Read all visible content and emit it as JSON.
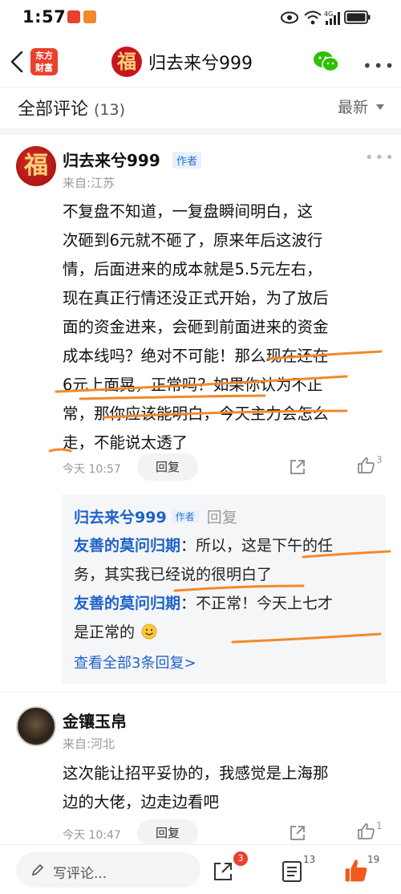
{
  "status": {
    "time": "1:57"
  },
  "nav": {
    "logo_line1": "东方",
    "logo_line2": "财富",
    "avatar_char": "福",
    "title": "归去来兮999"
  },
  "section": {
    "title": "全部评论",
    "count": "(13)",
    "sort": "最新"
  },
  "comments": [
    {
      "avatar_char": "福",
      "name": "归去来兮999",
      "author_tag": "作者",
      "from": "来自:江苏",
      "lines": [
        "不复盘不知道，一复盘瞬间明白，这",
        "次砸到6元就不砸了，原来年后这波行",
        "情，后面进来的成本就是5.5元左右，",
        "现在真正行情还没正式开始，为了放后",
        "面的资金进来，会砸到前面进来的资金",
        "成本线吗？绝对不可能！那么现在还在",
        "6元上面晃，正常吗？如果你认为不正",
        "常，那你应该能明白，今天主力会怎么",
        "走，不能说太透了"
      ],
      "time": "今天 10:57",
      "reply_label": "回复",
      "likes": "3"
    },
    {
      "name": "金镶玉帛",
      "from": "来自:河北",
      "lines": [
        "这次能让招平妥协的，我感觉是上海那",
        "边的大佬，边走边看吧"
      ],
      "time": "今天 10:47",
      "reply_label": "回复",
      "likes": "1"
    }
  ],
  "replies": {
    "header_name": "归去来兮999",
    "header_tag": "作者",
    "header_action": "回复",
    "items": [
      {
        "name": "友善的莫问归期",
        "line1": "：所以，这是下午的任",
        "line2": "务，其实我已经说的很明白了"
      },
      {
        "name": "友善的莫问归期",
        "line1": "：不正常！今天上七才",
        "line2": "是正常的"
      }
    ],
    "see_all": "查看全部3条回复>"
  },
  "bottom": {
    "write_placeholder": "写评论...",
    "share_badge": "3",
    "comment_count": "13",
    "like_count": "19"
  },
  "colors": {
    "accent": "#e8412d",
    "link": "#1e62c8",
    "annotation": "#f08a2a"
  }
}
